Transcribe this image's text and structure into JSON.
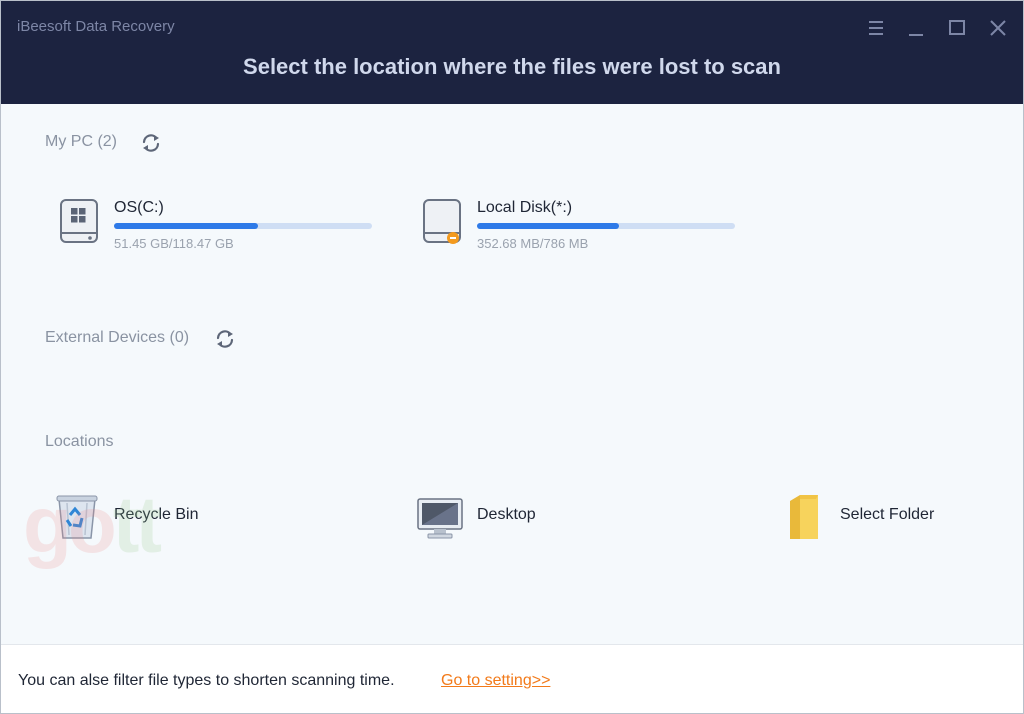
{
  "window": {
    "app_title": "iBeesoft Data Recovery",
    "headline": "Select the location where the files were lost to scan",
    "controls": [
      "menu-icon",
      "minimize-icon",
      "maximize-icon",
      "close-icon"
    ]
  },
  "my_pc": {
    "label": "My PC (2)",
    "drives": [
      {
        "name": "OS(C:)",
        "size": "51.45 GB/118.47 GB",
        "usage": 0.56,
        "icon": "windows-drive-icon"
      },
      {
        "name": "Local Disk(*:)",
        "size": "352.68 MB/786 MB",
        "usage": 0.55,
        "icon": "local-disk-icon"
      }
    ]
  },
  "external_devices": {
    "label": "External Devices (0)"
  },
  "locations": {
    "label": "Locations",
    "items": [
      {
        "name": "Recycle Bin",
        "icon": "recycle-bin-icon"
      },
      {
        "name": "Desktop",
        "icon": "desktop-icon"
      },
      {
        "name": "Select Folder",
        "icon": "folder-icon"
      }
    ]
  },
  "footer": {
    "text": "You can alse filter file types to shorten scanning time.",
    "link": "Go to setting>>"
  },
  "colors": {
    "header_bg": "#1c2340",
    "progress_fill": "#2e7ae8",
    "progress_track": "#cfdef4",
    "link": "#f27a1a"
  }
}
